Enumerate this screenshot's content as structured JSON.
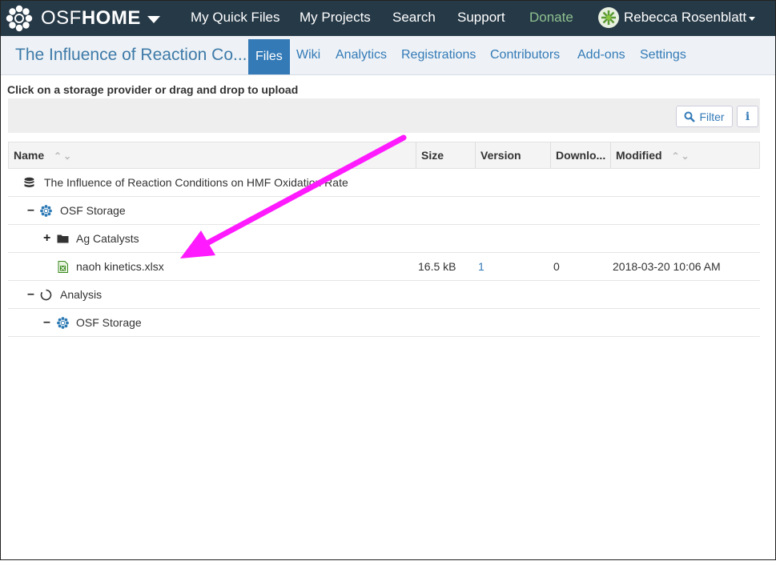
{
  "nav": {
    "brand_osf": "OSF",
    "brand_home": "HOME",
    "links": [
      "My Quick Files",
      "My Projects",
      "Search",
      "Support",
      "Donate"
    ],
    "user_name": "Rebecca Rosenblatt"
  },
  "project": {
    "title": "The Influence of Reaction Co...",
    "tabs": [
      "Files",
      "Wiki",
      "Analytics",
      "Registrations",
      "Contributors",
      "Add-ons",
      "Settings"
    ],
    "active_tab": "Files"
  },
  "upload_hint": "Click on a storage provider or drag and drop to upload",
  "toolbar": {
    "filter_label": "Filter",
    "info_label": "i"
  },
  "table": {
    "columns": [
      "Name",
      "Size",
      "Version",
      "Downlo...",
      "Modified"
    ],
    "rows": [
      {
        "toggle": "",
        "icon": "database-icon",
        "name": "The Influence of Reaction Conditions on HMF Oxidation Rate",
        "size": "",
        "version": "",
        "downloads": "",
        "modified": ""
      },
      {
        "toggle": "–",
        "icon": "osf-storage-icon",
        "name": "OSF Storage",
        "size": "",
        "version": "",
        "downloads": "",
        "modified": ""
      },
      {
        "toggle": "+",
        "icon": "folder-icon",
        "name": "Ag Catalysts",
        "size": "",
        "version": "",
        "downloads": "",
        "modified": ""
      },
      {
        "toggle": "",
        "icon": "excel-file-icon",
        "name": "naoh kinetics.xlsx",
        "size": "16.5 kB",
        "version": "1",
        "downloads": "0",
        "modified": "2018-03-20 10:06 AM"
      },
      {
        "toggle": "–",
        "icon": "component-icon",
        "name": "Analysis",
        "size": "",
        "version": "",
        "downloads": "",
        "modified": ""
      },
      {
        "toggle": "–",
        "icon": "osf-storage-icon",
        "name": "OSF Storage",
        "size": "",
        "version": "",
        "downloads": "",
        "modified": ""
      }
    ]
  },
  "colors": {
    "nav_bg": "#263947",
    "accent": "#337ab7",
    "donate": "#8fc28f",
    "annotation_arrow": "#ff1aff"
  }
}
